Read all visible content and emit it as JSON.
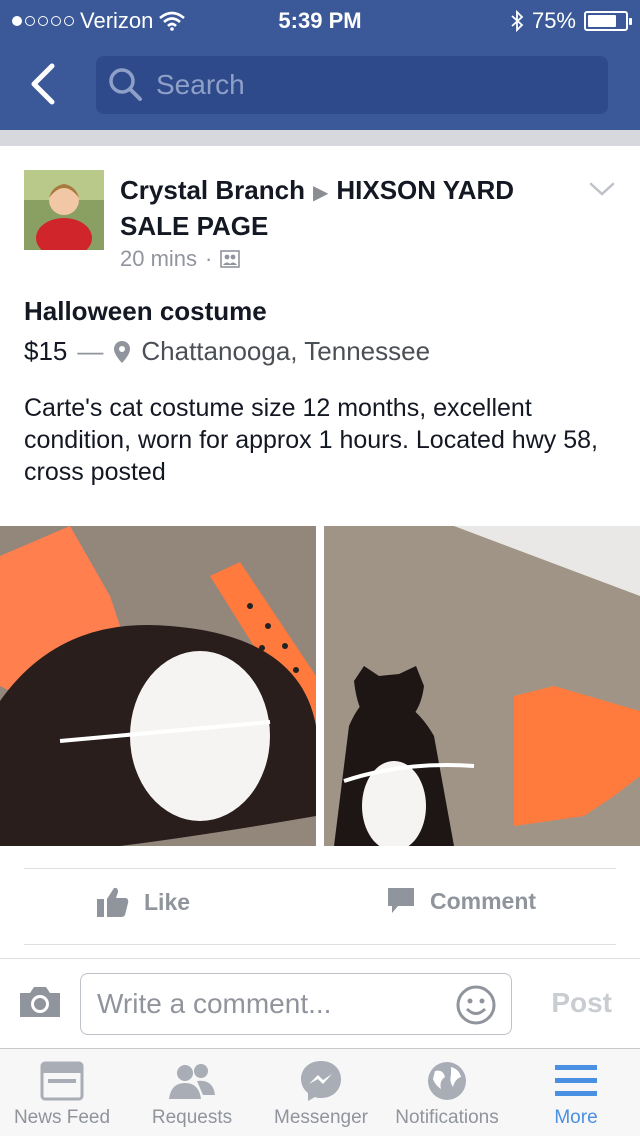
{
  "status_bar": {
    "carrier": "Verizon",
    "time": "5:39 PM",
    "battery": "75%",
    "battery_level": 0.75
  },
  "nav": {
    "search_placeholder": "Search"
  },
  "post": {
    "author": "Crystal Branch",
    "group": "HIXSON YARD SALE PAGE",
    "time_ago": "20 mins",
    "separator": "·",
    "item_title": "Halloween costume",
    "price": "$15",
    "dash": "—",
    "location": "Chattanooga, Tennessee",
    "description": "Carte's cat costume size 12 months, excellent condition, worn for approx 1 hours. Located hwy 58, cross posted"
  },
  "actions": {
    "like": "Like",
    "comment": "Comment"
  },
  "composer": {
    "placeholder": "Write a comment...",
    "post": "Post"
  },
  "tabs": [
    {
      "label": "News Feed",
      "icon": "news-feed-icon"
    },
    {
      "label": "Requests",
      "icon": "requests-icon"
    },
    {
      "label": "Messenger",
      "icon": "messenger-icon"
    },
    {
      "label": "Notifications",
      "icon": "globe-icon"
    },
    {
      "label": "More",
      "icon": "menu-icon"
    }
  ],
  "colors": {
    "brand": "#3b5998",
    "active_tab": "#4a90e2"
  }
}
